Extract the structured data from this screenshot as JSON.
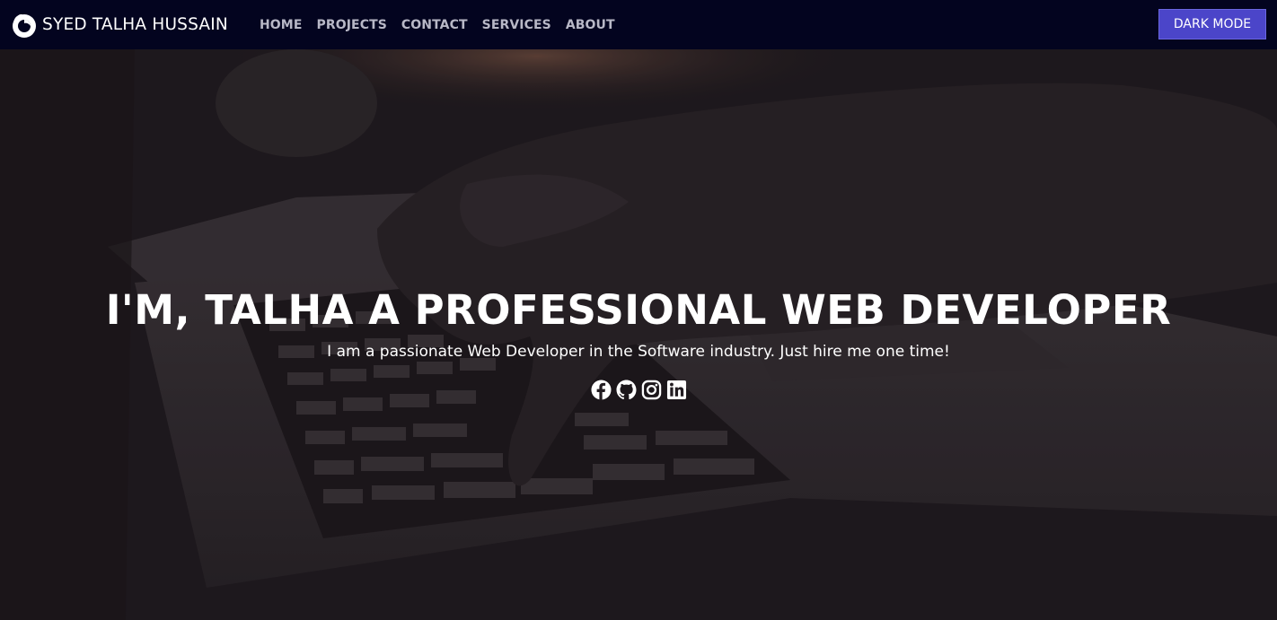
{
  "header": {
    "brand_name": "SYED TALHA HUSSAIN",
    "brand_icon": "firefox-logo-icon",
    "nav": [
      "HOME",
      "PROJECTS",
      "CONTACT",
      "SERVICES",
      "ABOUT"
    ],
    "dark_mode_label": "DARK MODE"
  },
  "hero": {
    "title": "I'M, TALHA A PROFESSIONAL WEB DEVELOPER",
    "subtitle": "I am a passionate Web Developer in the Software industry. Just hire me one time!",
    "background": "photo of hands typing on a laptop keyboard (darkened overlay)",
    "socials": [
      "facebook-icon",
      "github-icon",
      "instagram-icon",
      "linkedin-icon"
    ]
  },
  "colors": {
    "navbar_bg": "#03041f",
    "nav_link": "#b8b8c6",
    "button_bg": "#4b45c9",
    "hero_overlay": "#221c21",
    "text": "#ffffff"
  }
}
